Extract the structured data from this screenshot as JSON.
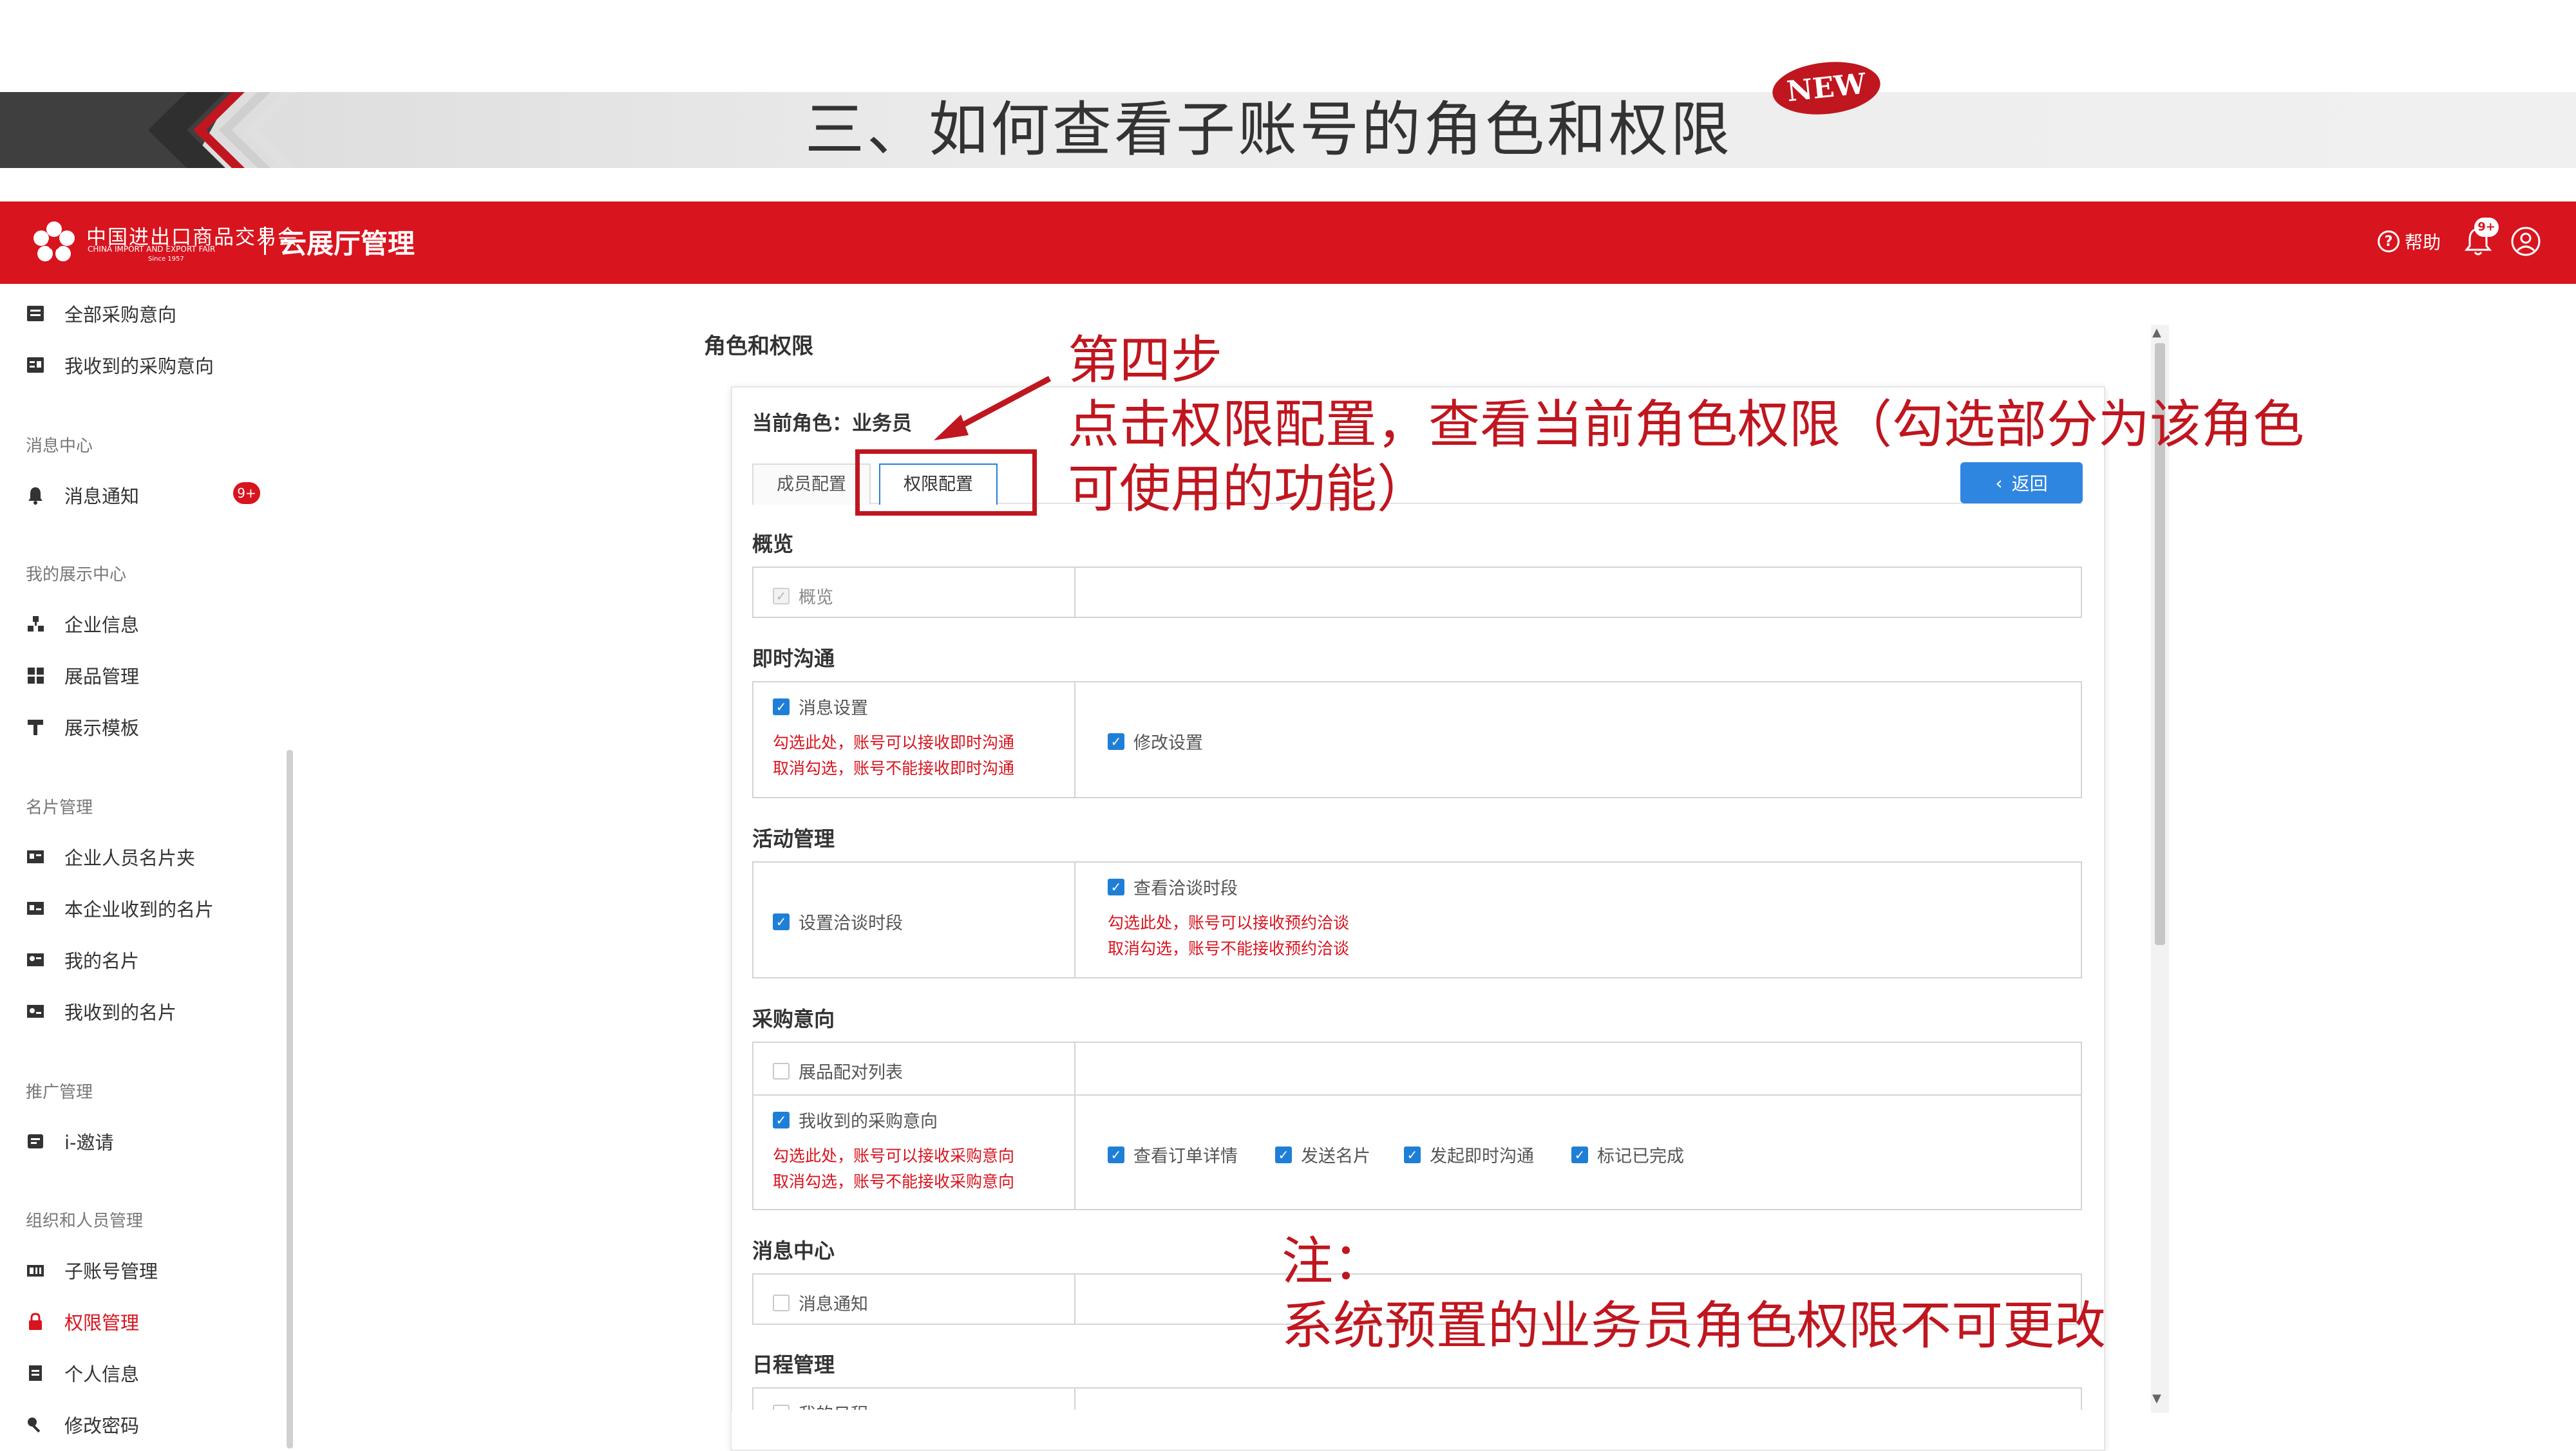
{
  "slide": {
    "title": "三、如何查看子账号的角色和权限",
    "badge": "NEW"
  },
  "header": {
    "logo_cn": "中国进出口商品交易会",
    "logo_en": "CHINA IMPORT AND EXPORT FAIR",
    "logo_since": "Since 1957",
    "app_name": "云展厅管理",
    "help_label": "帮助",
    "notification_badge": "9+",
    "brand_color": "#d8141e"
  },
  "sidebar": {
    "items_top": [
      {
        "label": "全部采购意向",
        "icon": "list-icon"
      },
      {
        "label": "我收到的采购意向",
        "icon": "inbox-list-icon"
      }
    ],
    "groups": [
      {
        "title": "消息中心",
        "items": [
          {
            "label": "消息通知",
            "icon": "bell-icon",
            "badge": "9+"
          }
        ]
      },
      {
        "title": "我的展示中心",
        "items": [
          {
            "label": "企业信息",
            "icon": "org-icon"
          },
          {
            "label": "展品管理",
            "icon": "grid-icon"
          },
          {
            "label": "展示模板",
            "icon": "template-icon"
          }
        ]
      },
      {
        "title": "名片管理",
        "items": [
          {
            "label": "企业人员名片夹",
            "icon": "card-folder-icon"
          },
          {
            "label": "本企业收到的名片",
            "icon": "card-received-icon"
          },
          {
            "label": "我的名片",
            "icon": "card-icon"
          },
          {
            "label": "我收到的名片",
            "icon": "card-inbox-icon"
          }
        ]
      },
      {
        "title": "推广管理",
        "items": [
          {
            "label": "i-邀请",
            "icon": "invite-icon"
          }
        ]
      },
      {
        "title": "组织和人员管理",
        "items": [
          {
            "label": "子账号管理",
            "icon": "subaccount-icon"
          },
          {
            "label": "权限管理",
            "icon": "lock-icon",
            "active": true
          },
          {
            "label": "个人信息",
            "icon": "profile-icon"
          },
          {
            "label": "修改密码",
            "icon": "key-icon"
          }
        ]
      }
    ]
  },
  "main": {
    "section_title": "角色和权限",
    "current_role": "当前角色：业务员",
    "tabs": [
      {
        "label": "成员配置"
      },
      {
        "label": "权限配置",
        "active": true
      }
    ],
    "back_button": "返回",
    "sections": {
      "overview": {
        "title": "概览",
        "item": "概览"
      },
      "im": {
        "title": "即时沟通",
        "left": "消息设置",
        "hint1": "勾选此处，账号可以接收即时沟通",
        "hint2": "取消勾选，账号不能接收即时沟通",
        "right": "修改设置"
      },
      "activity": {
        "title": "活动管理",
        "left": "设置洽谈时段",
        "right": "查看洽谈时段",
        "hint1": "勾选此处，账号可以接收预约洽谈",
        "hint2": "取消勾选，账号不能接收预约洽谈"
      },
      "purchase": {
        "title": "采购意向",
        "row1": "展品配对列表",
        "row2": "我收到的采购意向",
        "hint1": "勾选此处，账号可以接收采购意向",
        "hint2": "取消勾选，账号不能接收采购意向",
        "rights": [
          "查看订单详情",
          "发送名片",
          "发起即时沟通",
          "标记已完成"
        ]
      },
      "message": {
        "title": "消息中心",
        "item": "消息通知"
      },
      "schedule": {
        "title": "日程管理",
        "item": "我的日程"
      }
    }
  },
  "annotations": {
    "step_title": "第四步",
    "step_desc1": "点击权限配置，查看当前角色权限（勾选部分为该角色",
    "step_desc2": "可使用的功能）",
    "note_title": "注：",
    "note_text": "系统预置的业务员角色权限不可更改",
    "annotation_color": "#c0161f"
  }
}
